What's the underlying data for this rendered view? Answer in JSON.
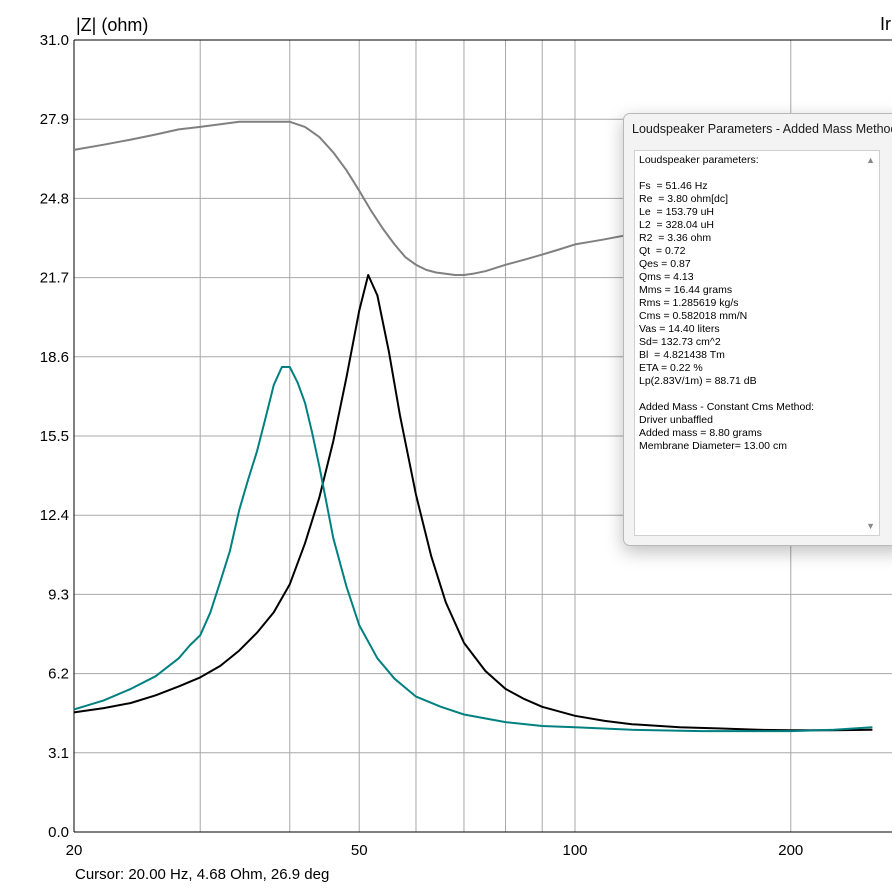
{
  "chart_data": {
    "type": "line",
    "ylabel": "|Z| (ohm)",
    "right_label_fragment": "Ir",
    "xscale": "log",
    "xlim": [
      20,
      260
    ],
    "ylim": [
      0,
      31
    ],
    "yticks": [
      "0.0",
      "3.1",
      "6.2",
      "9.3",
      "12.4",
      "15.5",
      "18.6",
      "21.7",
      "24.8",
      "27.9",
      "31.0"
    ],
    "xticks": [
      {
        "v": 20,
        "label": "20"
      },
      {
        "v": 50,
        "label": "50"
      },
      {
        "v": 100,
        "label": "100"
      },
      {
        "v": 200,
        "label": "200"
      }
    ],
    "xgrid": [
      20,
      30,
      40,
      50,
      60,
      70,
      80,
      90,
      100,
      200
    ],
    "grid": true,
    "series": [
      {
        "color": "#808080",
        "x": [
          20,
          22,
          24,
          26,
          28,
          30,
          32,
          34,
          36,
          38,
          40,
          42,
          44,
          46,
          48,
          50,
          52,
          54,
          56,
          58,
          60,
          62,
          64,
          66,
          68,
          70,
          72,
          75,
          80,
          85,
          90,
          95,
          100,
          105,
          110,
          115,
          120,
          125,
          130,
          140
        ],
        "y": [
          26.7,
          26.9,
          27.1,
          27.3,
          27.5,
          27.6,
          27.7,
          27.8,
          27.8,
          27.8,
          27.8,
          27.6,
          27.2,
          26.6,
          25.9,
          25.1,
          24.3,
          23.6,
          23.0,
          22.5,
          22.2,
          22.0,
          21.9,
          21.85,
          21.8,
          21.8,
          21.85,
          21.95,
          22.2,
          22.4,
          22.6,
          22.8,
          23.0,
          23.1,
          23.2,
          23.3,
          23.4,
          23.5,
          23.5,
          23.6
        ]
      },
      {
        "color": "#000000",
        "x": [
          20,
          22,
          24,
          26,
          28,
          30,
          32,
          34,
          36,
          38,
          40,
          42,
          44,
          46,
          48,
          50,
          51.46,
          53,
          55,
          57,
          60,
          63,
          66,
          70,
          75,
          80,
          85,
          90,
          100,
          110,
          120,
          140,
          160,
          180,
          200,
          230,
          260
        ],
        "y": [
          4.68,
          4.85,
          5.05,
          5.35,
          5.7,
          6.05,
          6.5,
          7.1,
          7.8,
          8.6,
          9.7,
          11.3,
          13.1,
          15.3,
          17.8,
          20.4,
          21.8,
          21.0,
          18.8,
          16.3,
          13.2,
          10.8,
          9.0,
          7.4,
          6.3,
          5.6,
          5.2,
          4.9,
          4.55,
          4.35,
          4.22,
          4.1,
          4.05,
          4.0,
          3.98,
          3.98,
          4.0
        ]
      },
      {
        "color": "#008080",
        "x": [
          20,
          22,
          24,
          26,
          28,
          29,
          30,
          31,
          32,
          33,
          34,
          35,
          36,
          37,
          38,
          39,
          40,
          41,
          42,
          43,
          44,
          45,
          46,
          48,
          50,
          53,
          56,
          60,
          65,
          70,
          80,
          90,
          100,
          120,
          150,
          180,
          200,
          230,
          260
        ],
        "y": [
          4.8,
          5.15,
          5.6,
          6.1,
          6.8,
          7.3,
          7.7,
          8.6,
          9.8,
          11.0,
          12.6,
          13.8,
          14.9,
          16.2,
          17.5,
          18.2,
          18.2,
          17.6,
          16.8,
          15.6,
          14.3,
          12.9,
          11.5,
          9.6,
          8.1,
          6.8,
          6.0,
          5.3,
          4.9,
          4.6,
          4.3,
          4.15,
          4.1,
          4.0,
          3.95,
          3.95,
          3.95,
          4.0,
          4.1
        ]
      }
    ]
  },
  "cursor_text": "Cursor: 20.00 Hz, 4.68 Ohm, 26.9 deg",
  "param_window": {
    "title": "Loudspeaker Parameters - Added Mass Method",
    "lines": [
      "Loudspeaker parameters:",
      "",
      "Fs  = 51.46 Hz",
      "Re  = 3.80 ohm[dc]",
      "Le  = 153.79 uH",
      "L2  = 328.04 uH",
      "R2  = 3.36 ohm",
      "Qt  = 0.72",
      "Qes = 0.87",
      "Qms = 4.13",
      "Mms = 16.44 grams",
      "Rms = 1.285619 kg/s",
      "Cms = 0.582018 mm/N",
      "Vas = 14.40 liters",
      "Sd= 132.73 cm^2",
      "Bl  = 4.821438 Tm",
      "ETA = 0.22 %",
      "Lp(2.83V/1m) = 88.71 dB",
      "",
      "Added Mass - Constant Cms Method:",
      "Driver unbaffled",
      "Added mass = 8.80 grams",
      "Membrane Diameter= 13.00 cm"
    ],
    "scroll_up": "▲",
    "scroll_down": "▼"
  }
}
